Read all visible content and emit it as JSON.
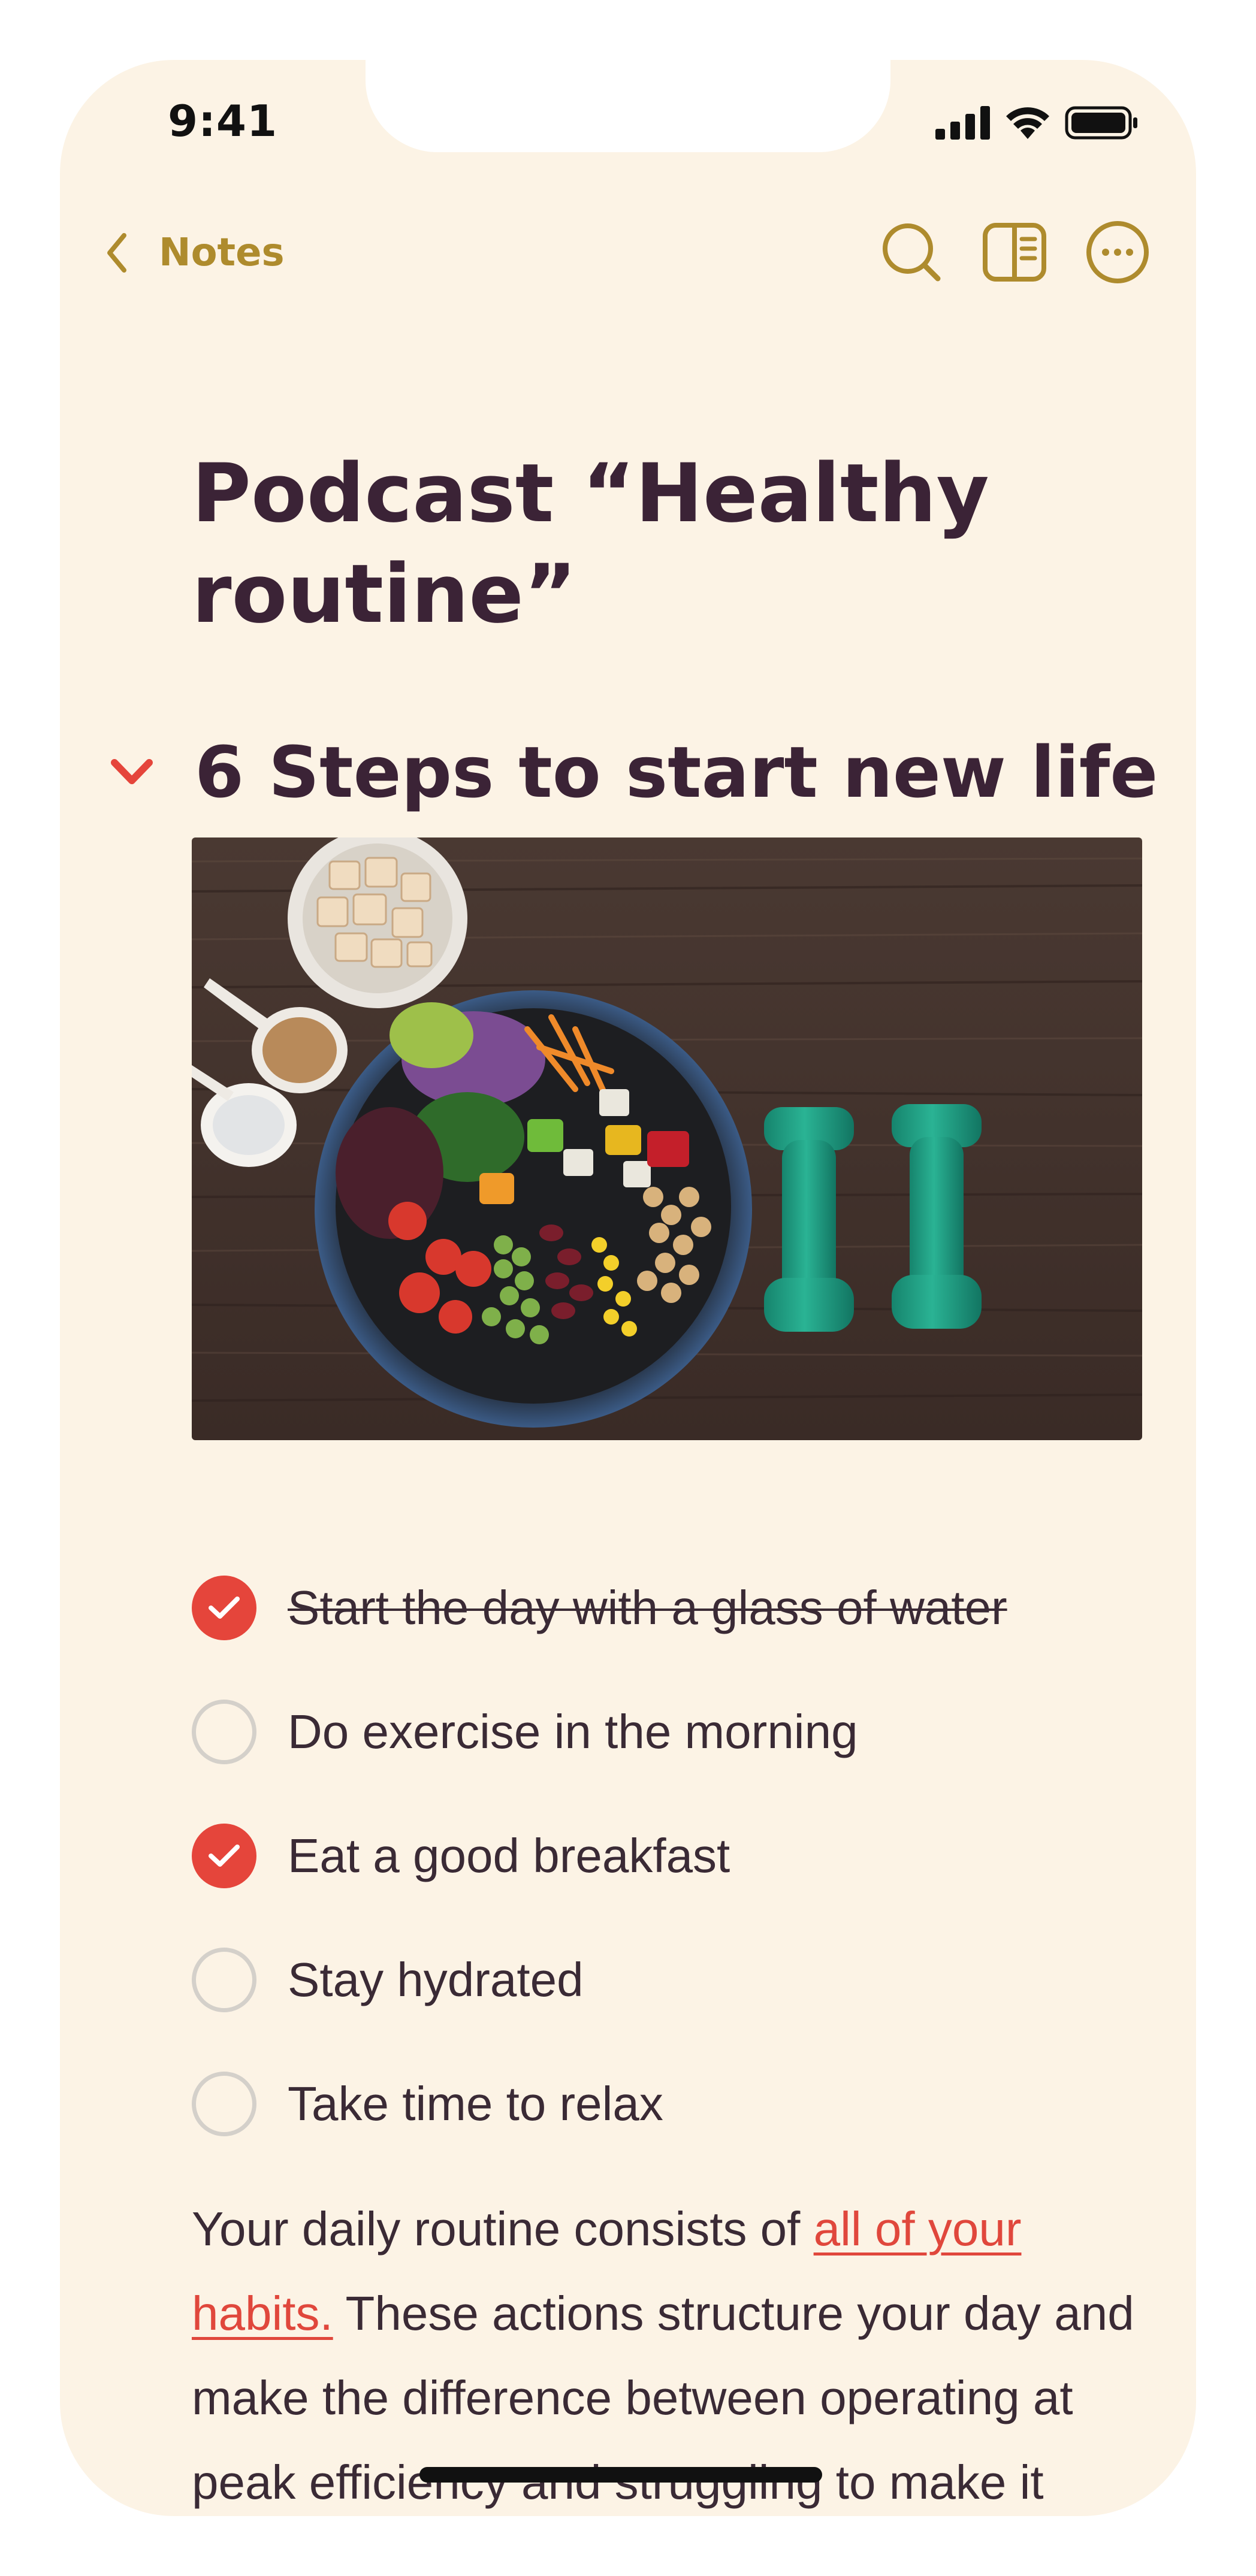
{
  "status_bar": {
    "time": "9:41",
    "icons": [
      "cellular-signal-icon",
      "wifi-icon",
      "battery-icon"
    ]
  },
  "nav": {
    "back_label": "Notes",
    "back_icon": "chevron-left-icon",
    "actions": [
      "search-icon",
      "sidebar-panel-icon",
      "more-ellipsis-icon"
    ]
  },
  "note": {
    "title": "Podcast “Healthy routine”",
    "section": {
      "title": "6 Steps to start new life",
      "collapse_icon": "chevron-down-icon",
      "image_subject": "salad bowl with vegetables, chickpeas and two green dumbbells on dark wood"
    },
    "checklist": [
      {
        "label": "Start the day with a glass of water",
        "checked": true
      },
      {
        "label": "Do exercise in the morning",
        "checked": false
      },
      {
        "label": "Eat a good breakfast",
        "checked": true
      },
      {
        "label": "Stay hydrated",
        "checked": false
      },
      {
        "label": "Take time to relax",
        "checked": false
      }
    ],
    "body": {
      "before_link": "Your daily routine consists of ",
      "link": "all of your habits.",
      "after_link": " These actions structure your day and make the difference between operating at peak efficiency and struggling to make it"
    }
  },
  "colors": {
    "background": "#fcf3e5",
    "accent_gold": "#ae8b2d",
    "heading": "#3b2336",
    "check_red": "#e5453b",
    "link_red": "#e0473c"
  }
}
